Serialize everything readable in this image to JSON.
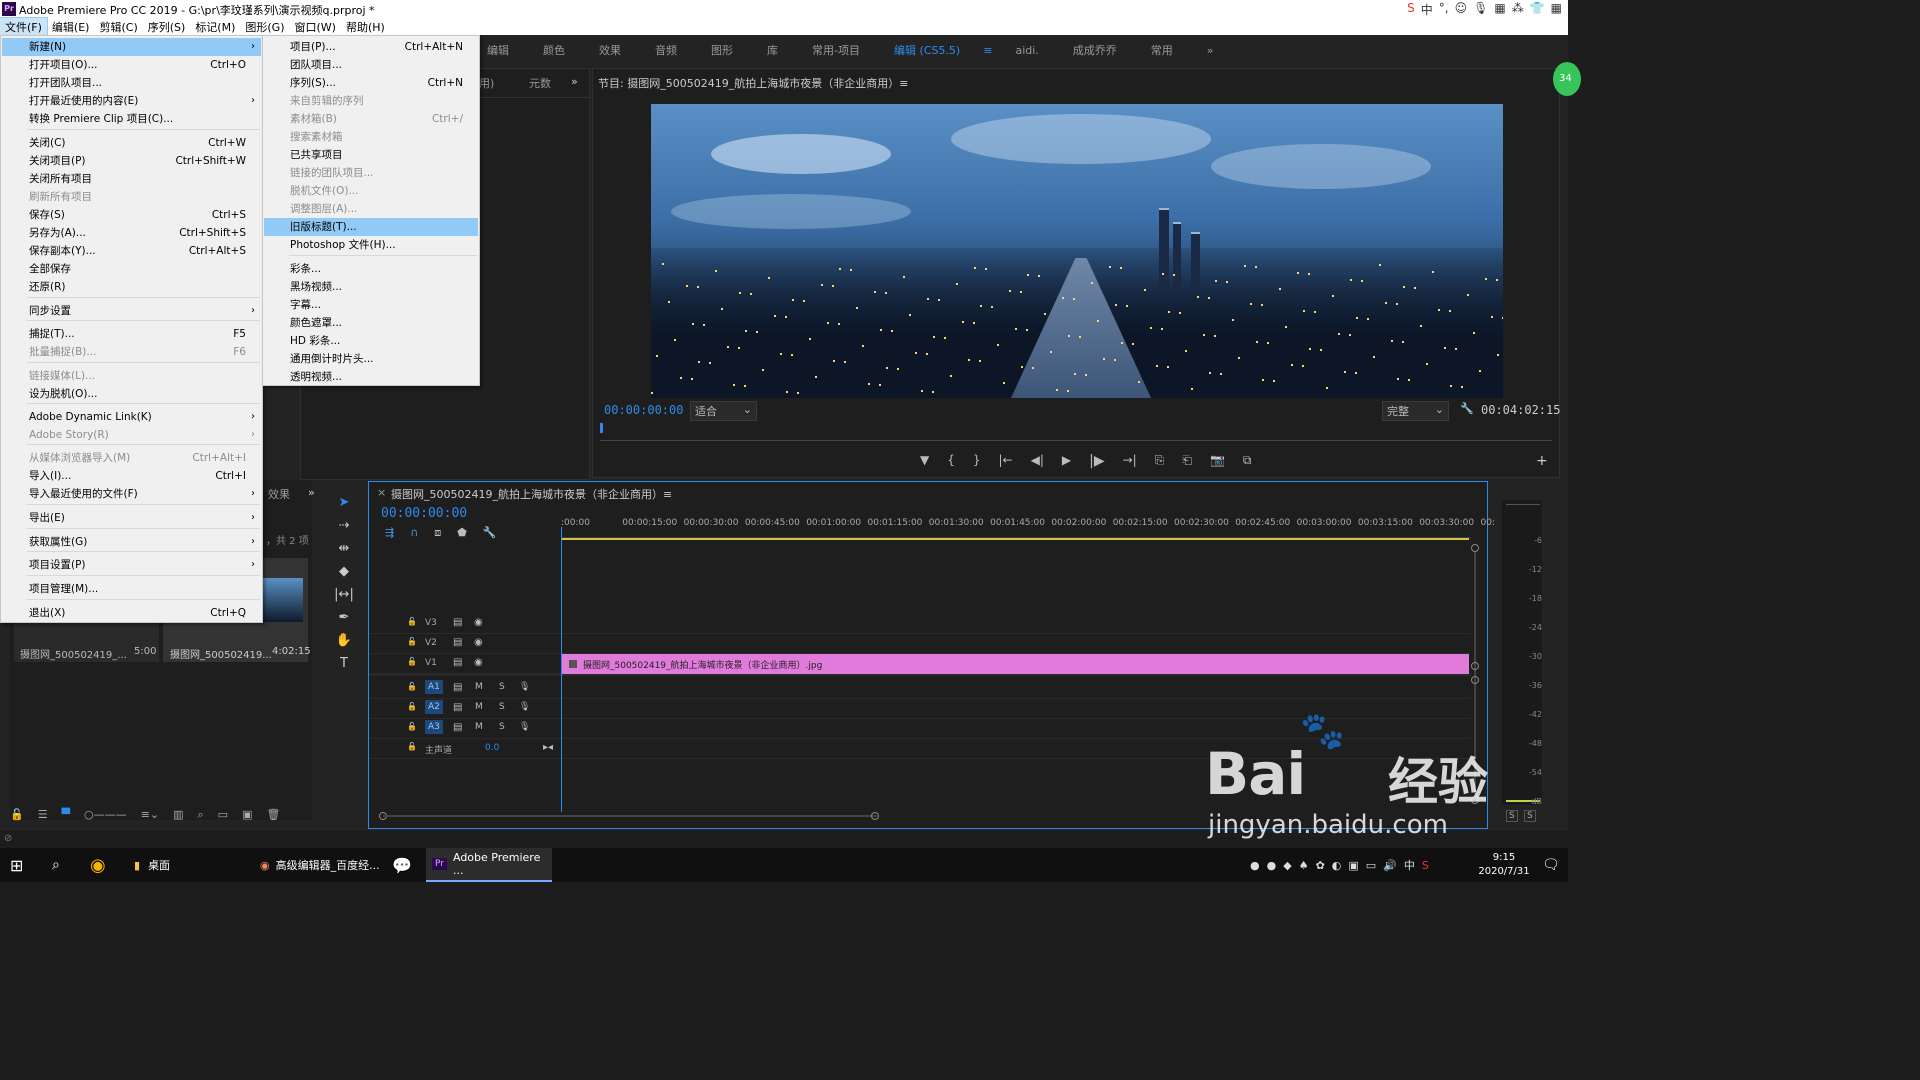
{
  "window": {
    "title": "Adobe Premiere Pro CC 2019 - G:\\pr\\李玟瑾系列\\演示视频q.prproj *",
    "app_badge": "Pr"
  },
  "tray_top": [
    "S",
    "中",
    "°,",
    "☺",
    "🎙",
    "▦",
    "⁂",
    "👕",
    "▦"
  ],
  "menubar": [
    "文件(F)",
    "编辑(E)",
    "剪辑(C)",
    "序列(S)",
    "标记(M)",
    "图形(G)",
    "窗口(W)",
    "帮助(H)"
  ],
  "workspaces": [
    "编辑",
    "颜色",
    "效果",
    "音频",
    "图形",
    "库",
    "常用-项目",
    "编辑 (CS5.5)",
    "≡",
    "aidi.",
    "成成乔乔",
    "常用",
    "»"
  ],
  "source_panel": {
    "tabs": [
      "用)",
      "元数",
      "»"
    ]
  },
  "program": {
    "header": "节目: 摄图网_500502419_航拍上海城市夜景（非企业商用）≡",
    "timecode": "00:00:00:00",
    "fit": "适合",
    "quality": "完整",
    "duration": "00:04:02:15",
    "controls": [
      "▼",
      "{",
      "}",
      "|←",
      "◀|",
      "▶",
      "|▶",
      "→|",
      "⎘",
      "⎗",
      "📷",
      "⧉"
    ],
    "add": "+"
  },
  "file_menu": {
    "items": [
      {
        "label": "新建(N)",
        "shortcut": "",
        "submenu": true,
        "state": "highlight"
      },
      {
        "label": "打开项目(O)...",
        "shortcut": "Ctrl+O"
      },
      {
        "label": "打开团队项目...",
        "shortcut": ""
      },
      {
        "label": "打开最近使用的内容(E)",
        "shortcut": "",
        "submenu": true
      },
      {
        "label": "转换 Premiere Clip 项目(C)...",
        "shortcut": ""
      },
      {
        "label": "关闭(C)",
        "shortcut": "Ctrl+W"
      },
      {
        "label": "关闭项目(P)",
        "shortcut": "Ctrl+Shift+W"
      },
      {
        "label": "关闭所有项目",
        "shortcut": ""
      },
      {
        "label": "刷新所有项目",
        "shortcut": "",
        "state": "disabled"
      },
      {
        "label": "保存(S)",
        "shortcut": "Ctrl+S"
      },
      {
        "label": "另存为(A)...",
        "shortcut": "Ctrl+Shift+S"
      },
      {
        "label": "保存副本(Y)...",
        "shortcut": "Ctrl+Alt+S"
      },
      {
        "label": "全部保存",
        "shortcut": ""
      },
      {
        "label": "还原(R)",
        "shortcut": ""
      },
      {
        "label": "同步设置",
        "shortcut": "",
        "submenu": true
      },
      {
        "label": "捕捉(T)...",
        "shortcut": "F5"
      },
      {
        "label": "批量捕捉(B)...",
        "shortcut": "F6",
        "state": "disabled"
      },
      {
        "label": "链接媒体(L)...",
        "shortcut": "",
        "state": "disabled"
      },
      {
        "label": "设为脱机(O)...",
        "shortcut": ""
      },
      {
        "label": "Adobe Dynamic Link(K)",
        "shortcut": "",
        "submenu": true
      },
      {
        "label": "Adobe Story(R)",
        "shortcut": "",
        "submenu": true,
        "state": "disabled"
      },
      {
        "label": "从媒体浏览器导入(M)",
        "shortcut": "Ctrl+Alt+I",
        "state": "disabled"
      },
      {
        "label": "导入(I)...",
        "shortcut": "Ctrl+I"
      },
      {
        "label": "导入最近使用的文件(F)",
        "shortcut": "",
        "submenu": true
      },
      {
        "label": "导出(E)",
        "shortcut": "",
        "submenu": true
      },
      {
        "label": "获取属性(G)",
        "shortcut": "",
        "submenu": true
      },
      {
        "label": "项目设置(P)",
        "shortcut": "",
        "submenu": true
      },
      {
        "label": "项目管理(M)...",
        "shortcut": ""
      },
      {
        "label": "退出(X)",
        "shortcut": "Ctrl+Q"
      }
    ]
  },
  "new_submenu": {
    "items": [
      {
        "label": "项目(P)...",
        "shortcut": "Ctrl+Alt+N"
      },
      {
        "label": "团队项目...",
        "shortcut": ""
      },
      {
        "label": "序列(S)...",
        "shortcut": "Ctrl+N"
      },
      {
        "label": "来自剪辑的序列",
        "shortcut": "",
        "state": "disabled"
      },
      {
        "label": "素材箱(B)",
        "shortcut": "Ctrl+/",
        "state": "disabled"
      },
      {
        "label": "搜索素材箱",
        "shortcut": "",
        "state": "disabled"
      },
      {
        "label": "已共享项目",
        "shortcut": ""
      },
      {
        "label": "链接的团队项目...",
        "shortcut": "",
        "state": "disabled"
      },
      {
        "label": "脱机文件(O)...",
        "shortcut": "",
        "state": "disabled"
      },
      {
        "label": "调整图层(A)...",
        "shortcut": "",
        "state": "disabled"
      },
      {
        "label": "旧版标题(T)...",
        "shortcut": "",
        "state": "highlight"
      },
      {
        "label": "Photoshop 文件(H)...",
        "shortcut": ""
      },
      {
        "label": "彩条...",
        "shortcut": ""
      },
      {
        "label": "黑场视频...",
        "shortcut": ""
      },
      {
        "label": "字幕...",
        "shortcut": ""
      },
      {
        "label": "颜色遮罩...",
        "shortcut": ""
      },
      {
        "label": "HD 彩条...",
        "shortcut": ""
      },
      {
        "label": "通用倒计时片头...",
        "shortcut": ""
      },
      {
        "label": "透明视频...",
        "shortcut": ""
      }
    ]
  },
  "project_panel": {
    "tabs": [
      "效果",
      "»"
    ],
    "count": "，共 2 项",
    "items": [
      {
        "name": "摄图网_500502419_...",
        "duration": "5:00"
      },
      {
        "name": "摄图网_500502419...",
        "duration": "4:02:15"
      }
    ]
  },
  "timeline": {
    "title": "摄图网_500502419_航拍上海城市夜景（非企业商用）≡",
    "timecode": "00:00:00:00",
    "ruler": [
      ":00:00",
      "00:00:15:00",
      "00:00:30:00",
      "00:00:45:00",
      "00:01:00:00",
      "00:01:15:00",
      "00:01:30:00",
      "00:01:45:00",
      "00:02:00:00",
      "00:02:15:00",
      "00:02:30:00",
      "00:02:45:00",
      "00:03:00:00",
      "00:03:15:00",
      "00:03:30:00",
      "00:"
    ],
    "video_tracks": [
      "V3",
      "V2",
      "V1"
    ],
    "audio_tracks": [
      "A1",
      "A2",
      "A3"
    ],
    "audio_ms": [
      "M",
      "S"
    ],
    "master": {
      "label": "主声道",
      "value": "0.0"
    },
    "clip": "摄图网_500502419_航拍上海城市夜景（非企业商用）.jpg"
  },
  "meter_scale": [
    "-6",
    "-12",
    "-18",
    "-24",
    "-30",
    "-36",
    "-42",
    "-48",
    "-54",
    "dB"
  ],
  "meter_solo": [
    "S",
    "S"
  ],
  "taskbar": {
    "items": [
      "桌面",
      "高级编辑器_百度经...",
      "Adobe Premiere ..."
    ],
    "clock": {
      "time": "9:15",
      "date": "2020/7/31"
    },
    "ime": "中"
  },
  "watermark": {
    "brand": "Bai",
    "cn": "经验",
    "url": "jingyan.baidu.com"
  },
  "green_badge": "34"
}
